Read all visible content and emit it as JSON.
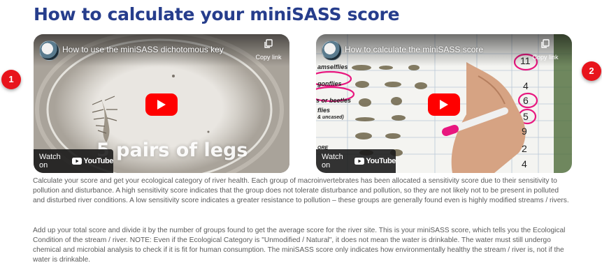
{
  "page": {
    "title": "How to calculate your miniSASS score"
  },
  "badges": [
    "1",
    "2"
  ],
  "videos": [
    {
      "title": "How to use the miniSASS dichotomous key",
      "copy_link_label": "Copy link",
      "watch_on_label": "Watch on",
      "youtube_label": "YouTube",
      "overlay_caption": "5 pairs of legs"
    },
    {
      "title": "How to calculate the miniSASS score",
      "copy_link_label": "Copy link",
      "watch_on_label": "Watch on",
      "youtube_label": "YouTube",
      "chart_rows": [
        "amselflies",
        "gonflies",
        "s or beetles",
        "flies",
        "& uncased)",
        "",
        "ORE"
      ],
      "scores": [
        "11",
        "4",
        "6",
        "5",
        "9",
        "2",
        "4"
      ]
    }
  ],
  "body": {
    "paragraph_1": "Calculate your score and get your ecological category of river health. Each group of macroinvertebrates has been allocated a sensitivity score due to their sensitivity to pollution and disturbance. A high sensitivity score indicates that the group does not tolerate disturbance and pollution, so they are not likely not to be present in polluted and disturbed river conditions. A low sensitivity score indicates a greater resistance to pollution – these groups are generally found even is highly modified streams / rivers.",
    "paragraph_2": "Add up your total score and divide it by the number of groups found to get the average score for the river site. This is your miniSASS score, which tells you the Ecological Condition of the stream / river. NOTE: Even if the Ecological Category is \"Unmodified / Natural\", it does not mean the water is drinkable. The water must still undergo chemical and microbial analysis to check if it is fit for human consumption. The miniSASS score only indicates how environmentally healthy the stream / river is, not if the water is drinkable."
  },
  "colors": {
    "title": "#263d8c",
    "badge": "#e8141c",
    "play": "#ff0000",
    "body_text": "#5b5b5b",
    "marker": "#e8177f"
  }
}
